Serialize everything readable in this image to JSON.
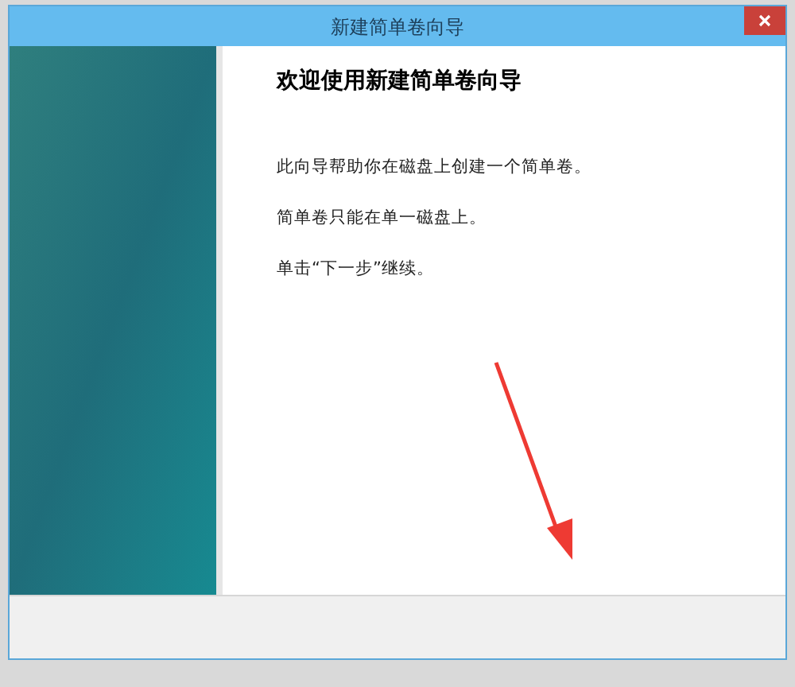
{
  "window": {
    "title": "新建简单卷向导"
  },
  "heading": "欢迎使用新建简单卷向导",
  "paragraphs": [
    "此向导帮助你在磁盘上创建一个简单卷。",
    "简单卷只能在单一磁盘上。",
    "单击“下一步”继续。"
  ]
}
